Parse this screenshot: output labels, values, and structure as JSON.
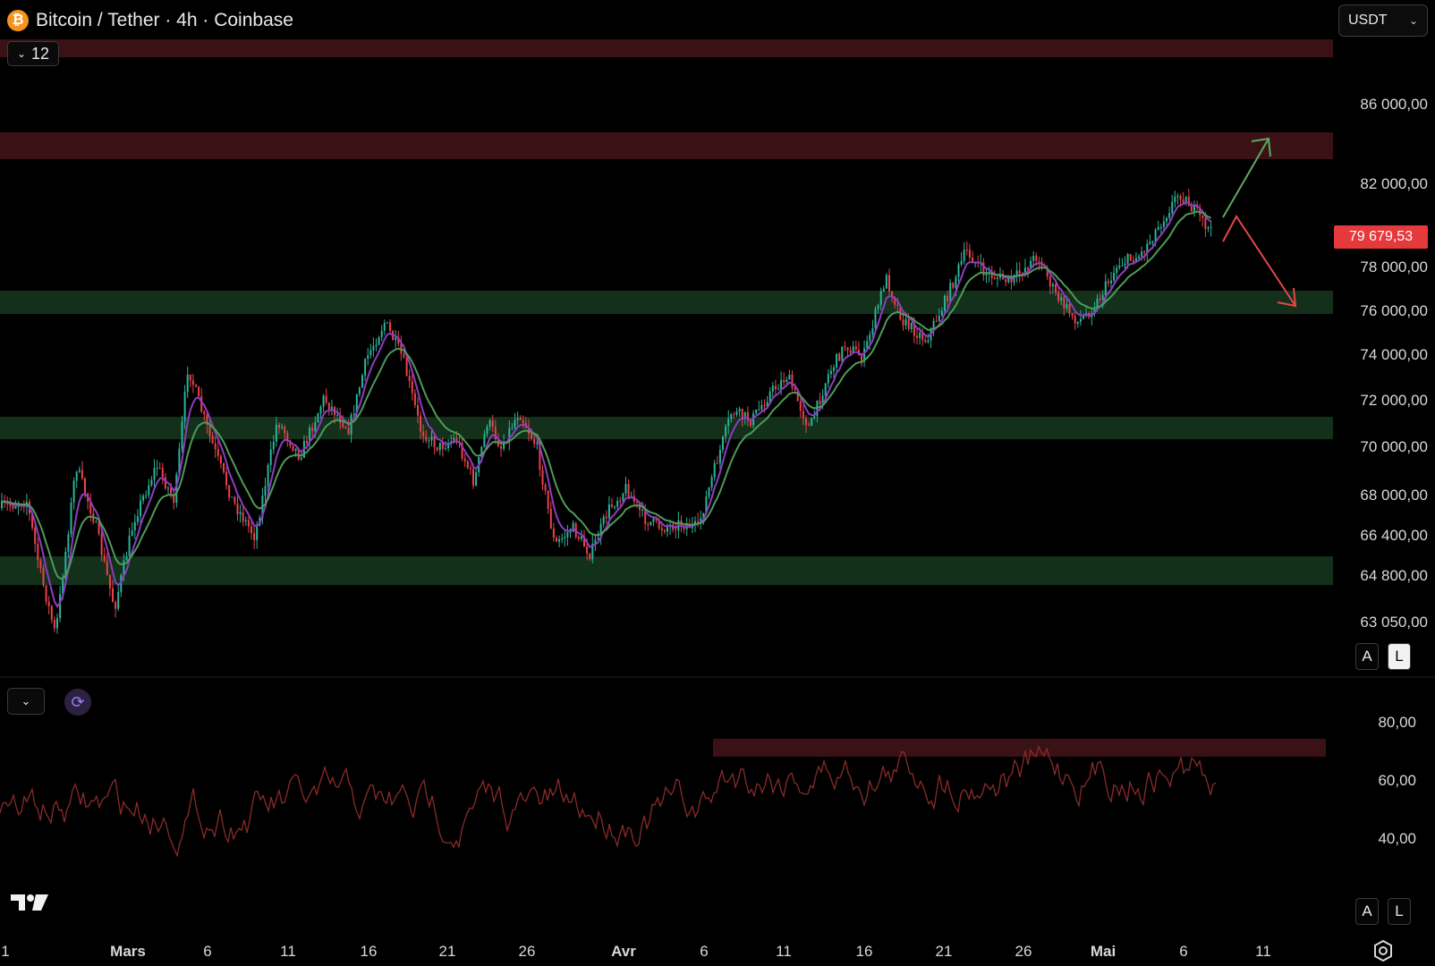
{
  "header": {
    "title": "Bitcoin / Tether · 4h · Coinbase",
    "collapse_count": "12",
    "currency_select": "USDT"
  },
  "price_axis": {
    "labels": [
      "86 000,00",
      "82 000,00",
      "78 000,00",
      "76 000,00",
      "74 000,00",
      "72 000,00",
      "70 000,00",
      "68 000,00",
      "66 400,00",
      "64 800,00",
      "63 050,00"
    ],
    "current_price": "79 679,53",
    "auto_label": "A",
    "log_label": "L"
  },
  "rsi_axis": {
    "labels": [
      "80,00",
      "60,00",
      "40,00"
    ],
    "auto_label": "A",
    "log_label": "L"
  },
  "time_axis": {
    "labels": [
      "1",
      "Mars",
      "6",
      "11",
      "16",
      "21",
      "26",
      "Avr",
      "6",
      "11",
      "16",
      "21",
      "26",
      "Mai",
      "6",
      "11"
    ]
  },
  "colors": {
    "background": "#000000",
    "resistance_zone": "#3a1216",
    "support_zone": "#12301a",
    "up_candle": "#2bb39a",
    "down_candle": "#e8434a",
    "ma_fast": "#8e3cc0",
    "ma_slow": "#4e9a5a",
    "rsi_line": "#8a2a2a",
    "up_arrow": "#5fa85f",
    "down_arrow": "#e34848",
    "price_tag": "#e5393c"
  },
  "icons": {
    "symbol": "bitcoin-icon",
    "sync": "sync-icon",
    "brand": "tradingview-logo",
    "settings": "settings-icon"
  }
}
